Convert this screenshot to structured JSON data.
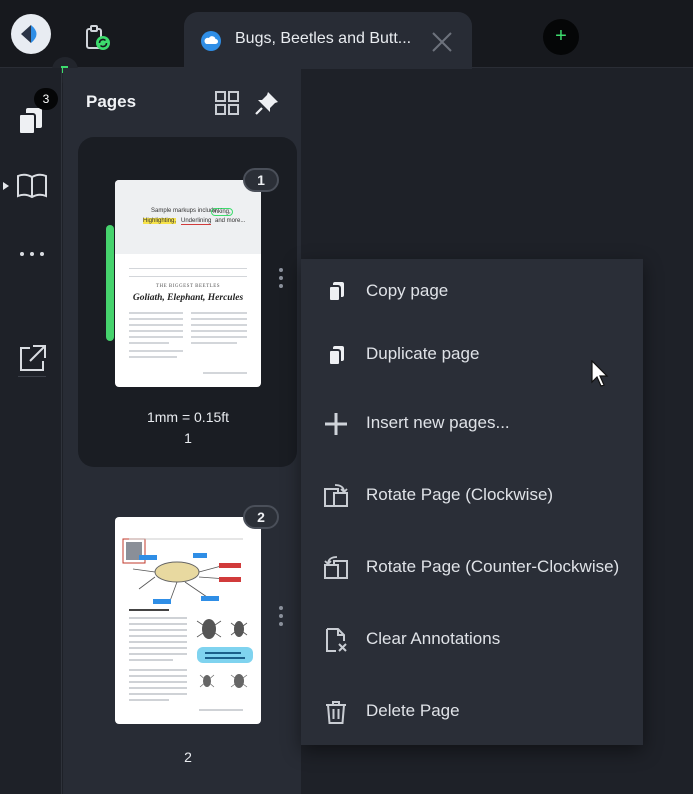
{
  "app": {
    "logo_icon": "app-logo-icon"
  },
  "tabs": {
    "active_title": "Bugs, Beetles and Butt...",
    "new_tab_symbol": "+"
  },
  "rail": {
    "pages_badge": "3"
  },
  "panel": {
    "title": "Pages",
    "pages": [
      {
        "number": "1",
        "caption": "1mm = 0.15ft",
        "label": "1",
        "selected": true
      },
      {
        "number": "2",
        "caption": "",
        "label": "2",
        "selected": false
      }
    ],
    "thumb1": {
      "keywords_line1": "Sample markups include",
      "kw_inking": "Inking,",
      "kw_highlighting": "Highlighting,",
      "kw_underlining": "Underlining",
      "kw_more": "and more...",
      "subtitle": "THE BIGGEST BEETLES",
      "title": "Goliath, Elephant, Hercules"
    }
  },
  "context_menu": {
    "items": [
      {
        "label": "Copy page",
        "icon": "copy-page-icon"
      },
      {
        "label": "Duplicate page",
        "icon": "duplicate-page-icon"
      },
      {
        "label": "Insert new pages...",
        "icon": "plus-icon"
      },
      {
        "label": "Rotate Page (Clockwise)",
        "icon": "rotate-clockwise-icon"
      },
      {
        "label": "Rotate Page (Counter-Clockwise)",
        "icon": "rotate-counter-clockwise-icon"
      },
      {
        "label": "Clear Annotations",
        "icon": "clear-annotations-icon"
      },
      {
        "label": "Delete Page",
        "icon": "trash-icon"
      }
    ]
  },
  "colors": {
    "accent_green": "#46d36d",
    "tab_icon_blue": "#2f8ee6"
  }
}
